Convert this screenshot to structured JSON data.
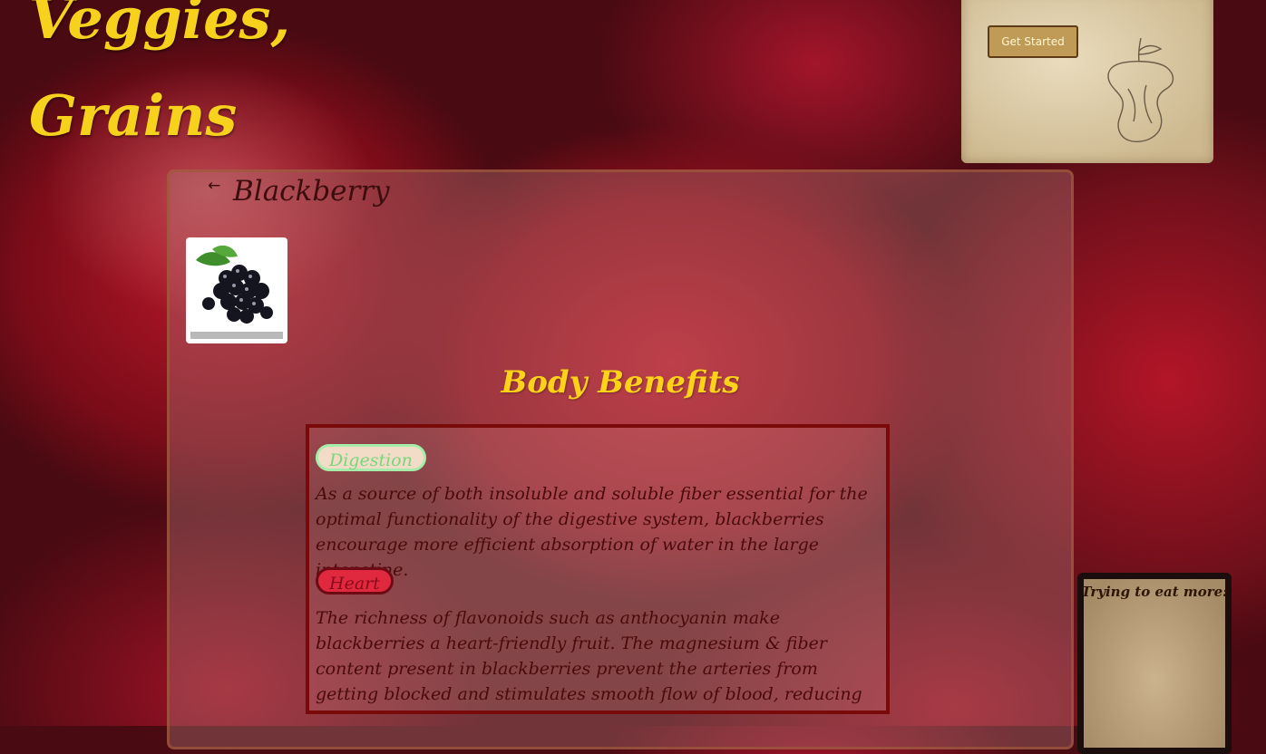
{
  "header": {
    "title_line1": "Veggies,",
    "title_line2": "Grains"
  },
  "promo": {
    "button_label": "Get Started"
  },
  "item": {
    "name": "Blackberry",
    "back_icon": "arrow-left-icon"
  },
  "benefits": {
    "section_title": "Body Benefits",
    "entries": [
      {
        "category": "Digestion",
        "text": "As a source of both insoluble and soluble fiber essential for the optimal functionality of the digestive system, blackberries encourage more efficient absorption of water in the large intenstine."
      },
      {
        "category": "Heart",
        "text": "The richness of flavonoids such as anthocyanin make blackberries a heart-friendly fruit. The magnesium & fiber content present in blackberries prevent the arteries from getting blocked and stimulates smooth flow of blood, reducing the risk of heart diseases such as stroke, maintaining"
      }
    ]
  },
  "sidebar_right": {
    "title": "Trying to eat more:"
  }
}
